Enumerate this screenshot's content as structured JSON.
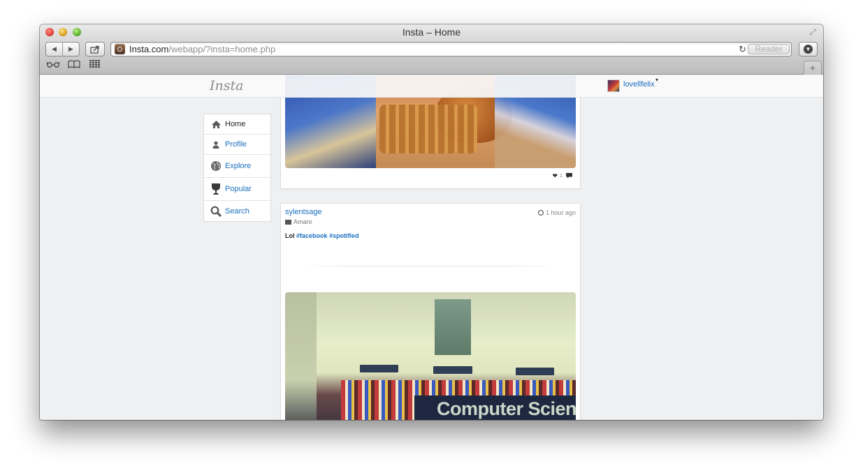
{
  "window": {
    "title": "Insta – Home",
    "url_host": "Insta.com",
    "url_path": "/webapp/?insta=home.php",
    "reader_label": "Reader",
    "new_tab_label": "+"
  },
  "site": {
    "logo_text": "Insta",
    "username": "lovellfelix",
    "menu": [
      {
        "label": "Home",
        "icon": "home-icon",
        "active": true
      },
      {
        "label": "Profile",
        "icon": "person-icon"
      },
      {
        "label": "Explore",
        "icon": "globe-icon"
      },
      {
        "label": "Popular",
        "icon": "trophy-icon"
      },
      {
        "label": "Search",
        "icon": "magnifier-icon"
      }
    ]
  },
  "feed": {
    "post1": {
      "likes_count": "1"
    },
    "post2": {
      "username": "sylentsage",
      "filter": "Amaro",
      "time": "1 hour ago",
      "caption_text": "Lol",
      "hashtags": [
        "#facebook",
        "#spotified"
      ],
      "photo_banner_text": "Computer Science"
    }
  },
  "colors": {
    "link": "#1a6fbf",
    "page_bg": "#eef0f2"
  }
}
